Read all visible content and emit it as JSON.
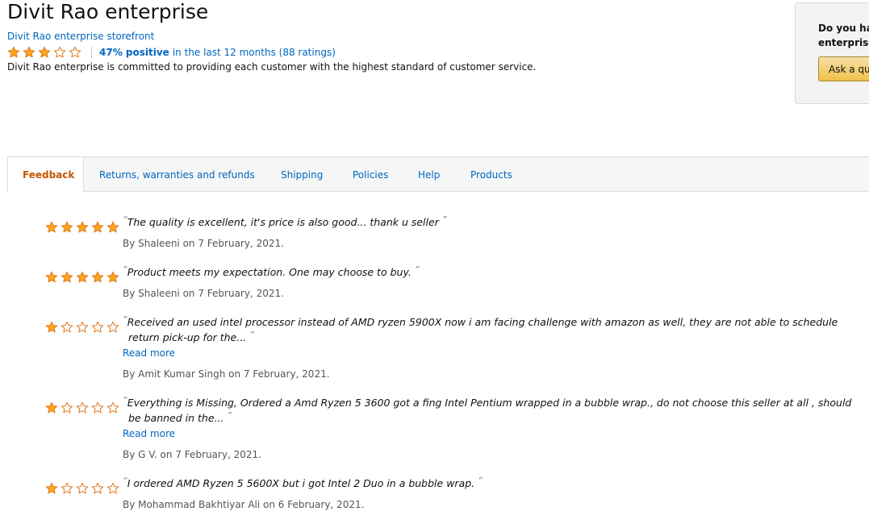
{
  "seller": {
    "name": "Divit Rao enterprise",
    "storefront_link": "Divit Rao enterprise storefront",
    "rating_stars": 3,
    "rating_positive": "47% positive",
    "rating_period": "in the last 12 months (88 ratings)",
    "description": "Divit Rao enterprise is committed to providing each customer with the highest standard of customer service."
  },
  "question_box": {
    "line1": "Do you hav",
    "line2": "enterprise",
    "button_label": "Ask a qu"
  },
  "tabs": [
    {
      "label": "Feedback",
      "active": true
    },
    {
      "label": "Returns, warranties and refunds",
      "active": false
    },
    {
      "label": "Shipping",
      "active": false
    },
    {
      "label": "Policies",
      "active": false
    },
    {
      "label": "Help",
      "active": false
    },
    {
      "label": "Products",
      "active": false
    }
  ],
  "reviews": [
    {
      "stars": 5,
      "quote": "The quality is excellent, it's price is also good... thank u seller",
      "read_more": "",
      "byline": "By Shaleeni on 7 February, 2021."
    },
    {
      "stars": 5,
      "quote": "Product meets my expectation. One may choose to buy.",
      "read_more": "",
      "byline": "By Shaleeni on 7 February, 2021."
    },
    {
      "stars": 1,
      "quote": "Received an used intel processor instead of AMD ryzen 5900X now i am facing challenge with amazon as well, they are not able to schedule return pick-up for the...",
      "read_more": "Read more",
      "byline": "By Amit Kumar Singh on 7 February, 2021."
    },
    {
      "stars": 1,
      "quote": "Everything is Missing, Ordered a Amd Ryzen 5 3600 got a fing Intel Pentium wrapped in a bubble wrap., do not choose this seller at all , should be banned in the...",
      "read_more": "Read more",
      "byline": "By G V. on 7 February, 2021."
    },
    {
      "stars": 1,
      "quote": "I ordered AMD Ryzen 5 5600X but i got Intel 2 Duo in a bubble wrap.",
      "read_more": "",
      "byline": "By Mohammad Bakhtiyar Ali on 6 February, 2021."
    }
  ],
  "colors": {
    "star_fill": "#ffa41c",
    "star_stroke": "#de7921",
    "link": "#0066c0",
    "active_tab": "#c45500"
  }
}
